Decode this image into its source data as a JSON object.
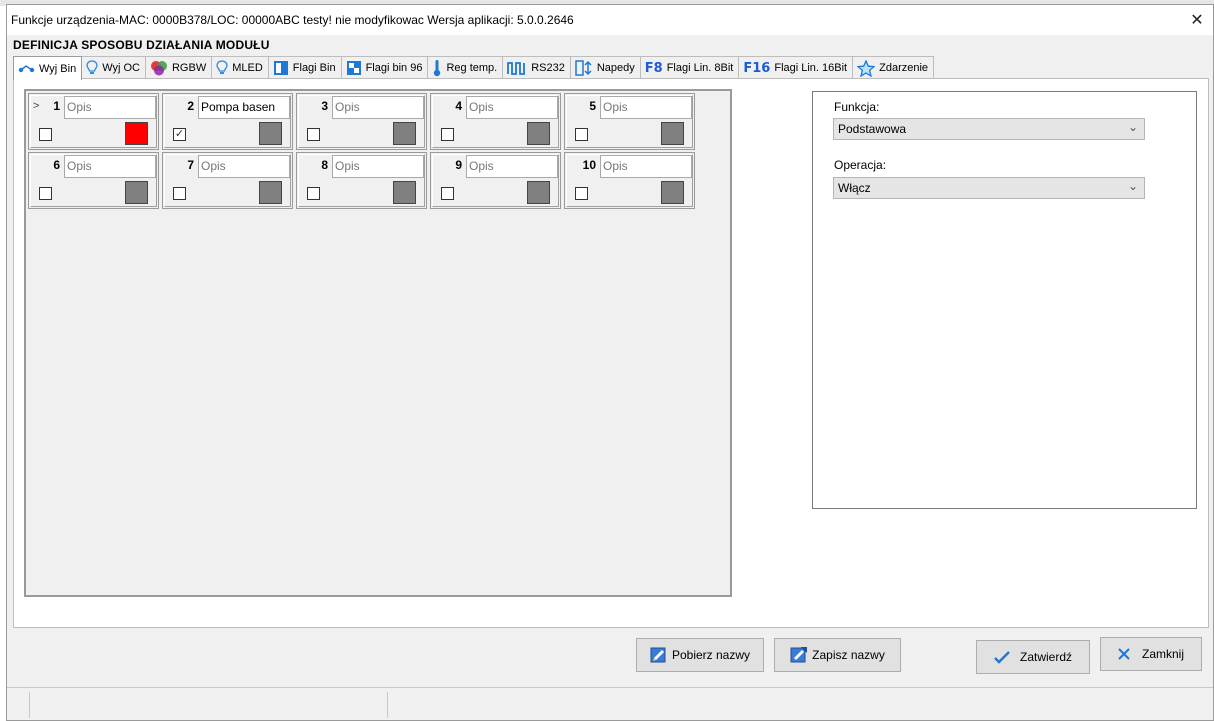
{
  "window": {
    "title": "Funkcje urządzenia-MAC: 0000B378/LOC: 00000ABC testy! nie modyfikowac Wersja aplikacji: 5.0.0.2646",
    "close_glyph": "✕"
  },
  "section_title": "DEFINICJA SPOSOBU DZIAŁANIA MODUŁU",
  "tabs": [
    {
      "label": "Wyj Bin",
      "icon": "output-bin-icon",
      "active": true
    },
    {
      "label": "Wyj OC",
      "icon": "bulb-outline-icon"
    },
    {
      "label": "RGBW",
      "icon": "rgb-circles-icon"
    },
    {
      "label": "MLED",
      "icon": "bulb-outline-icon"
    },
    {
      "label": "Flagi Bin",
      "icon": "flag-bin-icon"
    },
    {
      "label": "Flagi bin 96",
      "icon": "flag-bin-96-icon"
    },
    {
      "label": "Reg temp.",
      "icon": "thermometer-icon"
    },
    {
      "label": "RS232",
      "icon": "pulse-wave-icon"
    },
    {
      "label": "Napedy",
      "icon": "drive-icon"
    },
    {
      "label": "Flagi Lin. 8Bit",
      "icon": "f8-icon",
      "glyph": "F8"
    },
    {
      "label": "Flagi Lin. 16Bit",
      "icon": "f16-icon",
      "glyph": "F16"
    },
    {
      "label": "Zdarzenie",
      "icon": "star-icon"
    }
  ],
  "outputs": [
    {
      "number": "1",
      "name": "Opis",
      "placeholder": true,
      "checked": false,
      "color": "#ff0000",
      "selected": true
    },
    {
      "number": "2",
      "name": "Pompa basen",
      "placeholder": false,
      "checked": true,
      "color": "#808080"
    },
    {
      "number": "3",
      "name": "Opis",
      "placeholder": true,
      "checked": false,
      "color": "#808080"
    },
    {
      "number": "4",
      "name": "Opis",
      "placeholder": true,
      "checked": false,
      "color": "#808080"
    },
    {
      "number": "5",
      "name": "Opis",
      "placeholder": true,
      "checked": false,
      "color": "#808080"
    },
    {
      "number": "6",
      "name": "Opis",
      "placeholder": true,
      "checked": false,
      "color": "#808080"
    },
    {
      "number": "7",
      "name": "Opis",
      "placeholder": true,
      "checked": false,
      "color": "#808080"
    },
    {
      "number": "8",
      "name": "Opis",
      "placeholder": true,
      "checked": false,
      "color": "#808080"
    },
    {
      "number": "9",
      "name": "Opis",
      "placeholder": true,
      "checked": false,
      "color": "#808080"
    },
    {
      "number": "10",
      "name": "Opis",
      "placeholder": true,
      "checked": false,
      "color": "#808080"
    }
  ],
  "selected_marker": ">",
  "right_panel": {
    "funkcja_label": "Funkcja:",
    "funkcja_value": "Podstawowa",
    "operacja_label": "Operacja:",
    "operacja_value": "Włącz"
  },
  "buttons": {
    "pobierz": "Pobierz nazwy",
    "zapisz": "Zapisz nazwy",
    "zatwierdz": "Zatwierdź",
    "zamknij": "Zamknij"
  },
  "colors": {
    "accent_blue": "#1e5bd6",
    "active_red": "#ff0000",
    "inactive_gray": "#808080"
  }
}
